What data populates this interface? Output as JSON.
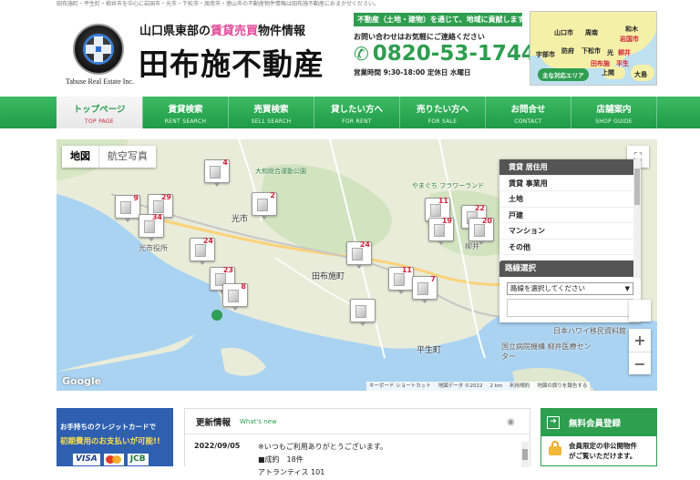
{
  "topline": "田布施町・平生町・柳井市を中心に岩国市・光市・下松市・周南市・徳山市の不動産物件情報は田布施不動産におまかせください。",
  "header": {
    "tagline_pre": "山口県東部の",
    "tagline_hl1": "賃貸",
    "tagline_hl2": "売買",
    "tagline_post": "物件情報",
    "company": "田布施不動産",
    "logo_sub": "Tabuse Real Estate Inc.",
    "slogan": "不動産（土地・建物）を通じて、地域に貢献します。",
    "ask": "お問い合わせはお気軽にご連絡ください",
    "phone": "0820-53-1744",
    "hours": "営業時間 9:30-18:00 定休日 水曜日"
  },
  "areamap": {
    "badge": "主な対応エリア",
    "cities": [
      {
        "name": "岩国市",
        "red": true
      },
      {
        "name": "和木",
        "red": false
      },
      {
        "name": "山口市",
        "red": false
      },
      {
        "name": "周南",
        "red": false
      },
      {
        "name": "宇部市",
        "red": false
      },
      {
        "name": "防府",
        "red": false
      },
      {
        "name": "下松市",
        "red": false
      },
      {
        "name": "光",
        "red": false
      },
      {
        "name": "柳井",
        "red": true
      },
      {
        "name": "田布施",
        "red": true
      },
      {
        "name": "平生",
        "red": true
      },
      {
        "name": "上関",
        "red": false
      },
      {
        "name": "大島",
        "red": false
      }
    ]
  },
  "nav": [
    {
      "jp": "トップページ",
      "en": "TOP PAGE",
      "active": true
    },
    {
      "jp": "賃貸検索",
      "en": "RENT SEARCH",
      "active": false
    },
    {
      "jp": "売買検索",
      "en": "SELL SEARCH",
      "active": false
    },
    {
      "jp": "貸したい方へ",
      "en": "FOR RENT",
      "active": false
    },
    {
      "jp": "売りたい方へ",
      "en": "FOR SALE",
      "active": false
    },
    {
      "jp": "お問合せ",
      "en": "CONTACT",
      "active": false
    },
    {
      "jp": "店舗案内",
      "en": "SHOP GUIDE",
      "active": false
    }
  ],
  "map": {
    "type_map": "地図",
    "type_sat": "航空写真",
    "google": "Google",
    "attrib_keys": "キーボード ショートカット",
    "attrib_data": "地図データ ©2022",
    "attrib_scale": "2 km",
    "attrib_terms": "利用規約",
    "attrib_report": "地図の誤りを報告する",
    "places": [
      {
        "label": "光市",
        "cls": "big"
      },
      {
        "label": "光市役所",
        "cls": ""
      },
      {
        "label": "田布施町",
        "cls": "big"
      },
      {
        "label": "平生町",
        "cls": "big"
      },
      {
        "label": "大和総合運動公園",
        "cls": ""
      },
      {
        "label": "やまぐち フラワーランド",
        "cls": ""
      },
      {
        "label": "日本ハワイ移民資料館",
        "cls": ""
      },
      {
        "label": "国立病院機構 柳井医療センター",
        "cls": ""
      },
      {
        "label": "柳井",
        "cls": ""
      }
    ],
    "pins": [
      "4",
      "9",
      "29",
      "34",
      "2",
      "24",
      "24",
      "23",
      "8",
      "11",
      "7",
      "11",
      "19",
      "22",
      "20",
      ""
    ]
  },
  "filter": {
    "items": [
      "賃貸 居住用",
      "賃貸 事業用",
      "土地",
      "戸建",
      "マンション",
      "その他"
    ],
    "line_head": "路線選択",
    "line_placeholder": "路線を選択してください"
  },
  "promo": {
    "l1": "お手持ちのクレジットカードで",
    "l2": "初期費用のお支払いが可能!!",
    "visa": "VISA",
    "jcb": "JCB"
  },
  "news": {
    "title": "更新情報",
    "en": "What's new",
    "date": "2022/09/05",
    "line1": "※いつもご利用ありがとうございます。",
    "line2": "■成約　18件",
    "line3": "アトランティス 101"
  },
  "member": {
    "title": "無料会員登録",
    "line1": "会員限定の非公開物件",
    "line2": "がご覧いただけます。"
  }
}
